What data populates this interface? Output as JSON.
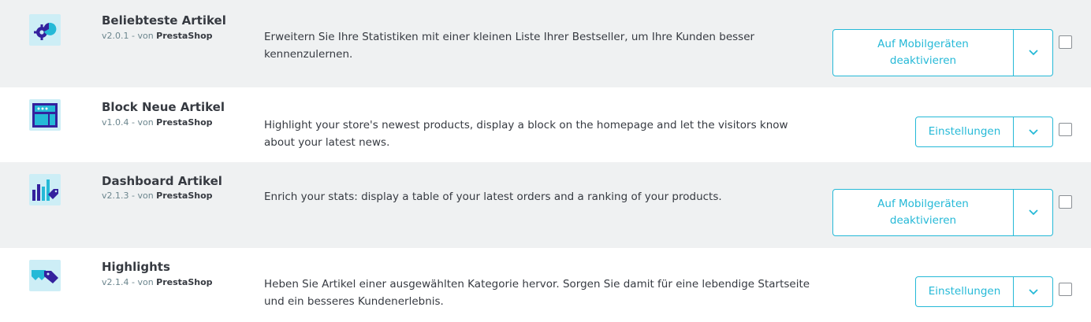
{
  "modules": [
    {
      "name": "Beliebteste Artikel",
      "version": "v2.0.1 - von ",
      "author": "PrestaShop",
      "description": "Erweitern Sie Ihre Statistiken mit einer kleinen Liste Ihrer Bestseller, um Ihre Kunden besser kennenzulernen.",
      "action_label": "Auf Mobilgeräten deaktivieren",
      "icon": "stats-pie-gear-icon",
      "checked": false
    },
    {
      "name": "Block Neue Artikel",
      "version": "v1.0.4 - von ",
      "author": "PrestaShop",
      "description": "Highlight your store's newest products, display a block on the homepage and let the visitors know about your latest news.",
      "action_label": "Einstellungen",
      "icon": "new-products-block-icon",
      "checked": false
    },
    {
      "name": "Dashboard Artikel",
      "version": "v2.1.3 - von ",
      "author": "PrestaShop",
      "description": "Enrich your stats: display a table of your latest orders and a ranking of your products.",
      "action_label": "Auf Mobilgeräten deaktivieren",
      "icon": "bar-chart-tag-icon",
      "checked": false
    },
    {
      "name": "Highlights",
      "version": "v2.1.4 - von ",
      "author": "PrestaShop",
      "description": "Heben Sie Artikel einer ausgewählten Kategorie hervor. Sorgen Sie damit für eine lebendige Startseite und ein besseres Kundenerlebnis.",
      "action_label": "Einstellungen",
      "icon": "tags-icon",
      "checked": false
    }
  ],
  "colors": {
    "accent": "#25b9d7",
    "icon_dark": "#34219e",
    "icon_bg": "#cdeef6",
    "alt_row_bg": "#eff1f2"
  }
}
